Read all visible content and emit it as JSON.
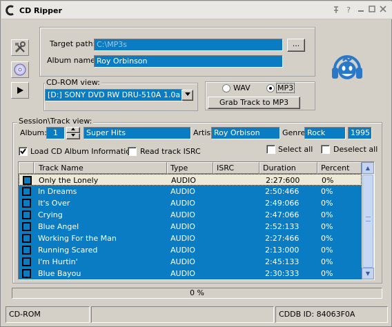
{
  "window": {
    "title": "CD Ripper",
    "controls": [
      "pin-icon",
      "minimize-icon",
      "close-icon"
    ]
  },
  "sidebar": {
    "buttons": [
      "tools-icon",
      "cd-icon",
      "play-icon"
    ]
  },
  "target": {
    "path_label": "Target path:",
    "path_value": "C:\\MP3s",
    "browse_label": "...",
    "album_label": "Album name:",
    "album_value": "Roy Orbinson"
  },
  "cdrom": {
    "group_label": "CD-ROM view:",
    "drive_value": "[D:]  SONY     DVD RW DRU-510A   1.0a"
  },
  "format": {
    "wav_label": "WAV",
    "mp3_label": "MP3",
    "selected": "MP3",
    "grab_label": "Grab Track to MP3"
  },
  "session": {
    "group_label": "Session\\Track view:",
    "album_label": "Album:",
    "album_number": "1",
    "album_title": "Super Hits",
    "artist_label": "Artist:",
    "artist_value": "Roy Orbison",
    "genre_label": "Genre:",
    "genre_value": "Rock",
    "year_value": "1995",
    "load_cd_label": "Load CD Album Information",
    "load_cd_checked": true,
    "read_isrc_label": "Read track ISRC",
    "select_all_label": "Select all",
    "deselect_all_label": "Deselect all"
  },
  "tracks": {
    "columns": [
      "Track Name",
      "Type",
      "ISRC",
      "Duration",
      "Percent"
    ],
    "rows": [
      {
        "name": "Only the Lonely",
        "type": "AUDIO",
        "isrc": "",
        "duration": "2:27:600",
        "percent": "0%"
      },
      {
        "name": "In Dreams",
        "type": "AUDIO",
        "isrc": "",
        "duration": "2:50:466",
        "percent": "0%"
      },
      {
        "name": "It's Over",
        "type": "AUDIO",
        "isrc": "",
        "duration": "2:49:066",
        "percent": "0%"
      },
      {
        "name": "Crying",
        "type": "AUDIO",
        "isrc": "",
        "duration": "2:47:066",
        "percent": "0%"
      },
      {
        "name": "Blue Angel",
        "type": "AUDIO",
        "isrc": "",
        "duration": "2:52:133",
        "percent": "0%"
      },
      {
        "name": "Working For the Man",
        "type": "AUDIO",
        "isrc": "",
        "duration": "2:27:466",
        "percent": "0%"
      },
      {
        "name": "Running Scared",
        "type": "AUDIO",
        "isrc": "",
        "duration": "2:13:000",
        "percent": "0%"
      },
      {
        "name": "I'm Hurtin'",
        "type": "AUDIO",
        "isrc": "",
        "duration": "2:45:133",
        "percent": "0%"
      },
      {
        "name": "Blue Bayou",
        "type": "AUDIO",
        "isrc": "",
        "duration": "2:30:333",
        "percent": "0%"
      }
    ]
  },
  "progress": {
    "text": "0 %",
    "value": 0
  },
  "statusbar": {
    "left": "CD-ROM",
    "middle": "",
    "right": "CDDB ID: 84063F0A"
  },
  "colors": {
    "selection": "#0a7cc4",
    "face": "#d4d0c8"
  }
}
